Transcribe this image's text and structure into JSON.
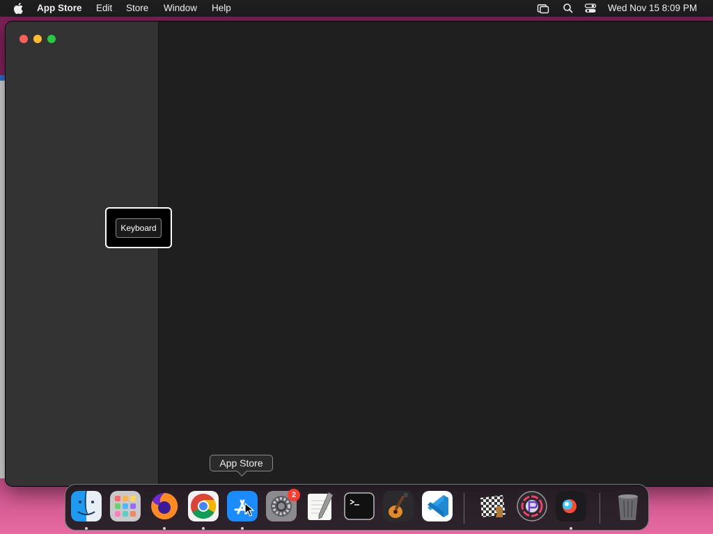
{
  "menubar": {
    "app_name": "App Store",
    "menus": [
      "Edit",
      "Store",
      "Window",
      "Help"
    ],
    "clock": "Wed Nov 15  8:09 PM",
    "status_icons": [
      "screen-mirroring-icon",
      "search-icon",
      "control-center-icon"
    ]
  },
  "window": {
    "tooltip_label": "Keyboard"
  },
  "dock": {
    "hover_tooltip": "App Store",
    "apps": [
      {
        "name": "Finder",
        "icon": "finder-icon",
        "running": true
      },
      {
        "name": "Launchpad",
        "icon": "launchpad-icon",
        "running": false
      },
      {
        "name": "Firefox",
        "icon": "firefox-icon",
        "running": true
      },
      {
        "name": "Google Chrome",
        "icon": "chrome-icon",
        "running": true
      },
      {
        "name": "App Store",
        "icon": "app-store-icon",
        "running": true
      },
      {
        "name": "System Settings",
        "icon": "system-settings-icon",
        "running": false,
        "badge": "2"
      },
      {
        "name": "TextEdit",
        "icon": "textedit-icon",
        "running": false
      },
      {
        "name": "Terminal",
        "icon": "terminal-icon",
        "running": false
      },
      {
        "name": "GarageBand",
        "icon": "garageband-icon",
        "running": false
      },
      {
        "name": "Visual Studio Code",
        "icon": "vscode-icon",
        "running": false
      },
      {
        "name": "Chess",
        "icon": "chess-icon",
        "running": false
      },
      {
        "name": "Pixelmator",
        "icon": "pixelmator-icon",
        "running": false
      },
      {
        "name": "Screen Recorder",
        "icon": "recorder-icon",
        "running": true
      },
      {
        "name": "Trash",
        "icon": "trash-icon",
        "running": false
      }
    ]
  }
}
